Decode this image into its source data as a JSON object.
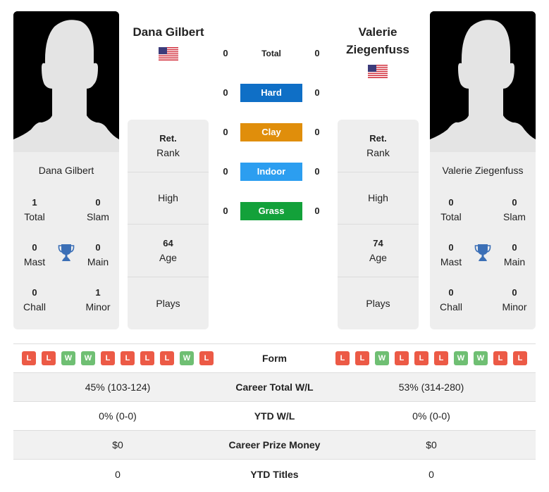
{
  "players": [
    {
      "name": "Dana Gilbert",
      "heading_lines": [
        "Dana Gilbert"
      ],
      "country": "USA",
      "flag_icon": "us-flag-icon",
      "titles": {
        "total": {
          "value": "1",
          "label": "Total"
        },
        "slam": {
          "value": "0",
          "label": "Slam"
        },
        "mast": {
          "value": "0",
          "label": "Mast"
        },
        "main": {
          "value": "0",
          "label": "Main"
        },
        "chall": {
          "value": "0",
          "label": "Chall"
        },
        "minor": {
          "value": "1",
          "label": "Minor"
        }
      },
      "info": {
        "rank": {
          "value": "Ret.",
          "label": "Rank"
        },
        "high": {
          "value": "",
          "label": "High"
        },
        "age": {
          "value": "64",
          "label": "Age"
        },
        "plays": {
          "value": "",
          "label": "Plays"
        }
      },
      "form": [
        "L",
        "L",
        "W",
        "W",
        "L",
        "L",
        "L",
        "L",
        "W",
        "L"
      ],
      "career_wl": "45% (103-124)",
      "ytd_wl": "0% (0-0)",
      "career_prize": "$0",
      "ytd_titles": "0"
    },
    {
      "name": "Valerie Ziegenfuss",
      "heading_lines": [
        "Valerie",
        "Ziegenfuss"
      ],
      "country": "USA",
      "flag_icon": "us-flag-icon",
      "titles": {
        "total": {
          "value": "0",
          "label": "Total"
        },
        "slam": {
          "value": "0",
          "label": "Slam"
        },
        "mast": {
          "value": "0",
          "label": "Mast"
        },
        "main": {
          "value": "0",
          "label": "Main"
        },
        "chall": {
          "value": "0",
          "label": "Chall"
        },
        "minor": {
          "value": "0",
          "label": "Minor"
        }
      },
      "info": {
        "rank": {
          "value": "Ret.",
          "label": "Rank"
        },
        "high": {
          "value": "",
          "label": "High"
        },
        "age": {
          "value": "74",
          "label": "Age"
        },
        "plays": {
          "value": "",
          "label": "Plays"
        }
      },
      "form": [
        "L",
        "L",
        "W",
        "L",
        "L",
        "L",
        "W",
        "W",
        "L",
        "L"
      ],
      "career_wl": "53% (314-280)",
      "ytd_wl": "0% (0-0)",
      "career_prize": "$0",
      "ytd_titles": "0"
    }
  ],
  "h2h": [
    {
      "label": "Total",
      "left": "0",
      "right": "0",
      "color": ""
    },
    {
      "label": "Hard",
      "left": "0",
      "right": "0",
      "color": "#0f6fc6"
    },
    {
      "label": "Clay",
      "left": "0",
      "right": "0",
      "color": "#e08e0b"
    },
    {
      "label": "Indoor",
      "left": "0",
      "right": "0",
      "color": "#2c9ef0"
    },
    {
      "label": "Grass",
      "left": "0",
      "right": "0",
      "color": "#13a13a"
    }
  ],
  "stats_labels": {
    "form": "Form",
    "career_wl": "Career Total W/L",
    "ytd_wl": "YTD W/L",
    "career_prize": "Career Prize Money",
    "ytd_titles": "YTD Titles"
  },
  "colors": {
    "loss": "#ec5a46",
    "win": "#6fbf73",
    "trophy": "#3b6fb6"
  }
}
